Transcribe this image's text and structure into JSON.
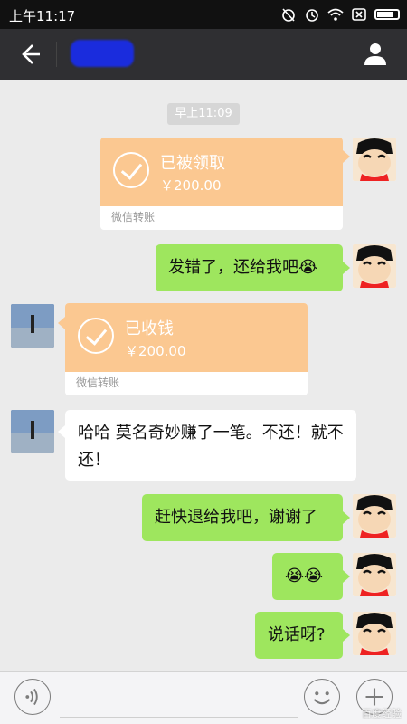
{
  "status_bar": {
    "time": "上午11:17",
    "icons": [
      "alarm-off-icon",
      "alarm-icon",
      "wifi-icon",
      "sim-off-icon",
      "battery-icon"
    ]
  },
  "header": {
    "contact_name": ""
  },
  "chat": {
    "timestamp": "早上11:09",
    "transfer_sent": {
      "status": "已被领取",
      "amount": "￥200.00",
      "brand": "微信转账"
    },
    "msg1": "发错了，还给我吧😭",
    "transfer_received": {
      "status": "已收钱",
      "amount": "￥200.00",
      "brand": "微信转账"
    },
    "msg2": "哈哈 莫名奇妙赚了一笔。不还！就不还！",
    "msg3": "赶快退给我吧，谢谢了",
    "msg4": "😭😭",
    "msg5": "说话呀?"
  },
  "input": {
    "placeholder": ""
  },
  "watermark": "百度经验",
  "colors": {
    "self_bubble": "#9ee65e",
    "other_bubble": "#ffffff",
    "transfer": "#fbc891",
    "title_bar": "#2f2f32"
  }
}
